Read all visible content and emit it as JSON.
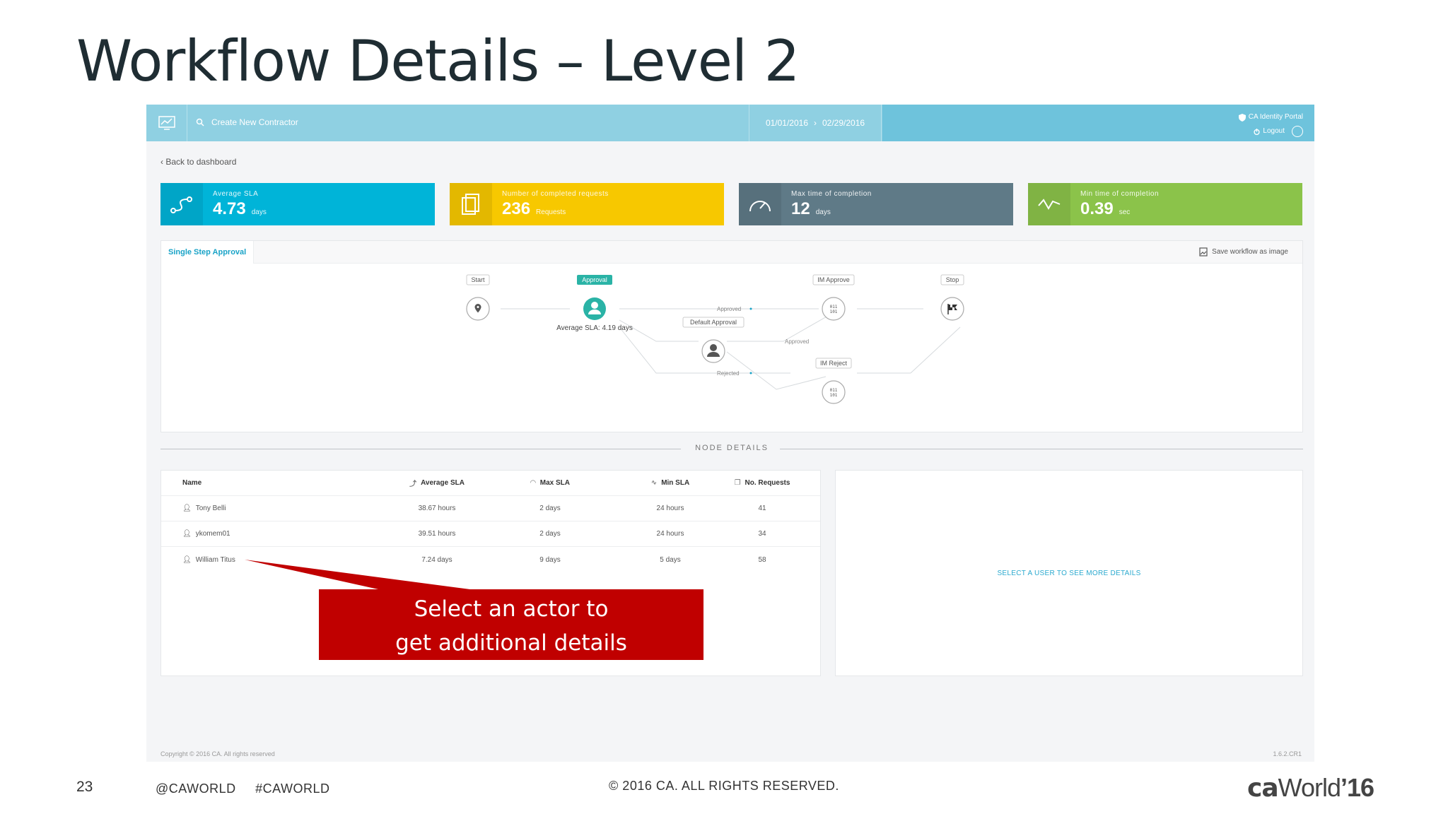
{
  "slide": {
    "title": "Workflow Details – Level 2",
    "number": "23",
    "hashtags": [
      "@CAWORLD",
      "#CAWORLD"
    ],
    "copyright": "© 2016 CA. ALL RIGHTS RESERVED.",
    "brand": {
      "ca": "ca",
      "world": "World",
      "year": "’16"
    }
  },
  "header": {
    "search_label": "Create New Contractor",
    "date_from": "01/01/2016",
    "date_to": "02/29/2016",
    "portal_label": "CA Identity Portal",
    "logout_label": "Logout"
  },
  "back_link": "Back to dashboard",
  "kpis": [
    {
      "label": "Average SLA",
      "value": "4.73",
      "unit": "days",
      "color": "#00b4d8"
    },
    {
      "label": "Number of completed requests",
      "value": "236",
      "unit": "Requests",
      "color": "#f7c800"
    },
    {
      "label": "Max time of completion",
      "value": "12",
      "unit": "days",
      "color": "#5f7a87"
    },
    {
      "label": "Min time of completion",
      "value": "0.39",
      "unit": "sec",
      "color": "#8bc34a"
    }
  ],
  "workflow": {
    "tab_label": "Single Step Approval",
    "save_label": "Save workflow as image",
    "nodes": {
      "start": "Start",
      "approval": "Approval",
      "approval_sla": "Average SLA: 4.19 days",
      "default_approval": "Default Approval",
      "im_approve": "IM Approve",
      "im_reject": "IM Reject",
      "stop": "Stop"
    },
    "edges": {
      "approved_1": "Approved",
      "approved_2": "Approved",
      "rejected": "Rejected"
    }
  },
  "node_details": {
    "section_title": "NODE DETAILS",
    "columns": [
      "Name",
      "Average SLA",
      "Max SLA",
      "Min SLA",
      "No. Requests"
    ],
    "rows": [
      {
        "name": "Tony Belli",
        "avg": "38.67 hours",
        "max": "2 days",
        "min": "24 hours",
        "req": "41"
      },
      {
        "name": "ykomem01",
        "avg": "39.51 hours",
        "max": "2 days",
        "min": "24 hours",
        "req": "34"
      },
      {
        "name": "William Titus",
        "avg": "7.24 days",
        "max": "9 days",
        "min": "5 days",
        "req": "58"
      }
    ],
    "detail_placeholder": "SELECT A USER TO SEE MORE DETAILS"
  },
  "footer": {
    "copyright": "Copyright © 2016 CA. All rights reserved",
    "version": "1.6.2.CR1"
  },
  "callout": {
    "line1": "Select an actor to",
    "line2": "get additional details"
  },
  "colors": {
    "accent": "#19a3c7",
    "header": "#8fd0e2",
    "callout": "#c00000"
  }
}
